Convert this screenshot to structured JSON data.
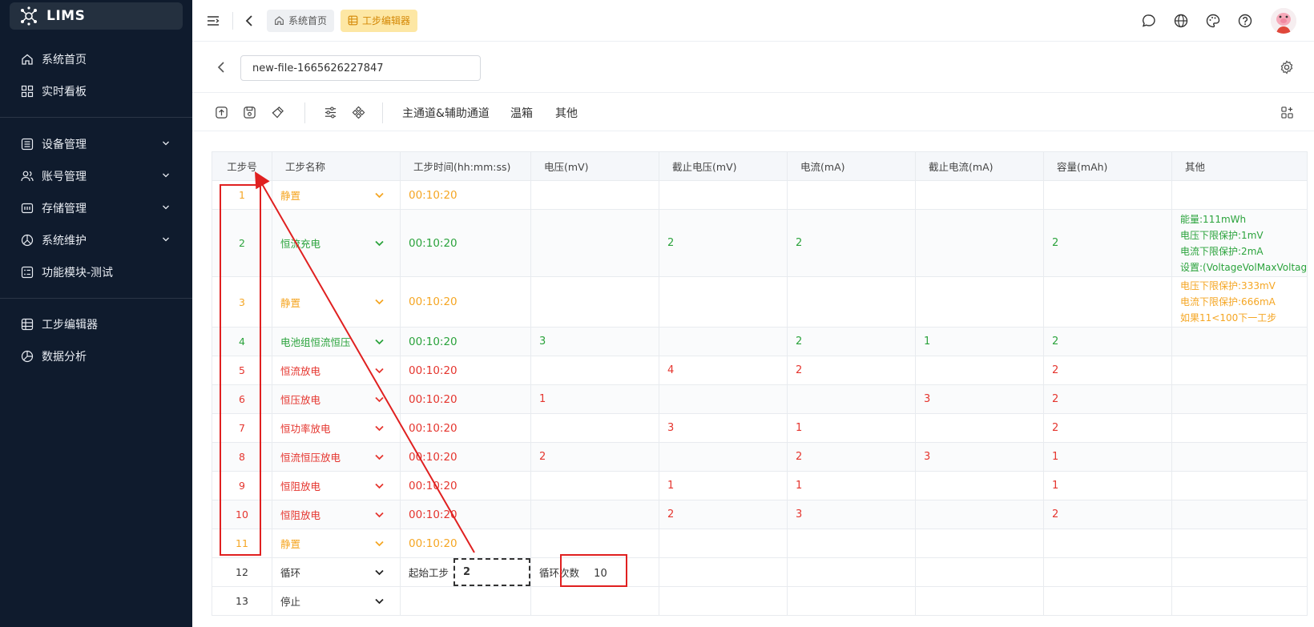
{
  "app": {
    "name": "LIMS"
  },
  "sidebar": {
    "items": [
      {
        "label": "系统首页",
        "icon": "home-icon"
      },
      {
        "label": "实时看板",
        "icon": "dashboard-icon"
      },
      {
        "label": "设备管理",
        "icon": "device-icon",
        "expandable": true
      },
      {
        "label": "账号管理",
        "icon": "users-icon",
        "expandable": true
      },
      {
        "label": "存储管理",
        "icon": "storage-icon",
        "expandable": true
      },
      {
        "label": "系统维护",
        "icon": "maintenance-icon",
        "expandable": true
      },
      {
        "label": "功能模块-测试",
        "icon": "module-icon"
      },
      {
        "label": "工步编辑器",
        "icon": "grid-icon"
      },
      {
        "label": "数据分析",
        "icon": "pie-chart-icon"
      }
    ]
  },
  "topbar": {
    "tabs": [
      {
        "label": "系统首页",
        "active": false
      },
      {
        "label": "工步编辑器",
        "active": true
      }
    ]
  },
  "file": {
    "name": "new-file-1665626227847"
  },
  "toolbar": {
    "tabs": [
      "主通道&辅助通道",
      "温箱",
      "其他"
    ]
  },
  "table": {
    "headers": [
      "工步号",
      "工步名称",
      "工步时间(hh:mm:ss)",
      "电压(mV)",
      "截止电压(mV)",
      "电流(mA)",
      "截止电流(mA)",
      "容量(mAh)",
      "其他"
    ],
    "rows": [
      {
        "step": "1",
        "name": "静置",
        "time": "00:10:20",
        "voltage": "",
        "cut_voltage": "",
        "current": "",
        "cut_current": "",
        "capacity": "",
        "other": [],
        "color": "#f5a623"
      },
      {
        "step": "2",
        "name": "恒流充电",
        "time": "00:10:20",
        "voltage": "",
        "cut_voltage": "2",
        "current": "2",
        "cut_current": "",
        "capacity": "2",
        "other": [
          "能量:111mWh",
          "电压下限保护:1mV",
          "电流下限保护:2mA",
          "设置:(VoltageVolMaxVoltag"
        ],
        "color": "#2ba33c"
      },
      {
        "step": "3",
        "name": "静置",
        "time": "00:10:20",
        "voltage": "",
        "cut_voltage": "",
        "current": "",
        "cut_current": "",
        "capacity": "",
        "other": [
          "电压下限保护:333mV",
          "电流下限保护:666mA",
          "如果11<100下一工步"
        ],
        "color": "#f5a623"
      },
      {
        "step": "4",
        "name": "电池组恒流恒压",
        "time": "00:10:20",
        "voltage": "3",
        "cut_voltage": "",
        "current": "2",
        "cut_current": "1",
        "capacity": "2",
        "other": [],
        "color": "#2ba33c"
      },
      {
        "step": "5",
        "name": "恒流放电",
        "time": "00:10:20",
        "voltage": "",
        "cut_voltage": "4",
        "current": "2",
        "cut_current": "",
        "capacity": "2",
        "other": [],
        "color": "#e5352e"
      },
      {
        "step": "6",
        "name": "恒压放电",
        "time": "00:10:20",
        "voltage": "1",
        "cut_voltage": "",
        "current": "",
        "cut_current": "3",
        "capacity": "2",
        "other": [],
        "color": "#e5352e"
      },
      {
        "step": "7",
        "name": "恒功率放电",
        "time": "00:10:20",
        "voltage": "",
        "cut_voltage": "3",
        "current": "1",
        "cut_current": "",
        "capacity": "2",
        "other": [],
        "color": "#e5352e"
      },
      {
        "step": "8",
        "name": "恒流恒压放电",
        "time": "00:10:20",
        "voltage": "2",
        "cut_voltage": "",
        "current": "2",
        "cut_current": "3",
        "capacity": "1",
        "other": [],
        "color": "#e5352e"
      },
      {
        "step": "9",
        "name": "恒阻放电",
        "time": "00:10:20",
        "voltage": "",
        "cut_voltage": "1",
        "current": "1",
        "cut_current": "",
        "capacity": "1",
        "other": [],
        "color": "#e5352e"
      },
      {
        "step": "10",
        "name": "恒阻放电",
        "time": "00:10:20",
        "voltage": "",
        "cut_voltage": "2",
        "current": "3",
        "cut_current": "",
        "capacity": "2",
        "other": [],
        "color": "#e5352e"
      },
      {
        "step": "11",
        "name": "静置",
        "time": "00:10:20",
        "voltage": "",
        "cut_voltage": "",
        "current": "",
        "cut_current": "",
        "capacity": "",
        "other": [],
        "color": "#f5a623"
      }
    ],
    "loop_row": {
      "step": "12",
      "name": "循环",
      "start_label": "起始工步",
      "start_value": "2",
      "count_label": "循环次数",
      "count_value": "10"
    },
    "stop_row": {
      "step": "13",
      "name": "停止"
    }
  },
  "colors": {
    "sidebar_bg": "#0f1b2d",
    "accent": "#fde7a4",
    "annotation": "#e02020"
  }
}
